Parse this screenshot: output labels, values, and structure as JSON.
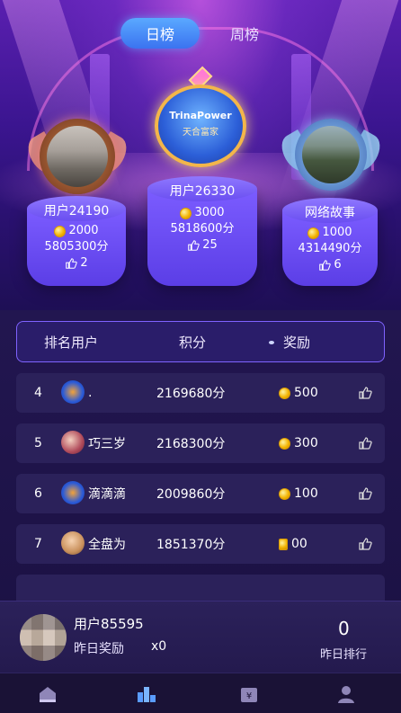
{
  "tabs": [
    {
      "label": "日榜",
      "active": true
    },
    {
      "label": "周榜",
      "active": false
    }
  ],
  "crown": {
    "brand": "TrinaPower",
    "brand_cn": "天合富家"
  },
  "podium": {
    "first": {
      "name": "用户26330",
      "coins": "3000",
      "score": "5818600分",
      "likes": "25"
    },
    "second": {
      "name": "用户24190",
      "coins": "2000",
      "score": "5805300分",
      "likes": "2"
    },
    "third": {
      "name": "网络故事",
      "coins": "1000",
      "score": "4314490分",
      "likes": "6"
    }
  },
  "table": {
    "headers": [
      "排名用户",
      "积分",
      "奖励"
    ],
    "rows": [
      {
        "rank": "4",
        "name": ".",
        "score": "2169680分",
        "reward": "500"
      },
      {
        "rank": "5",
        "name": "巧三岁",
        "score": "2168300分",
        "reward": "300"
      },
      {
        "rank": "6",
        "name": "滴滴滴",
        "score": "2009860分",
        "reward": "100"
      },
      {
        "rank": "7",
        "name": "全盘为",
        "score": "1851370分",
        "reward": "00"
      }
    ]
  },
  "me": {
    "name": "用户85595",
    "yesterday_label": "昨日奖励",
    "yesterday_value": "x0",
    "rank_value": "0",
    "rank_label": "昨日排行"
  },
  "nav": [
    "home-icon",
    "ranking-icon",
    "wallet-icon",
    "profile-icon"
  ],
  "colors": {
    "accent": "#3b73f0",
    "podium": "#6a4ef0",
    "row": "#2b215a",
    "coin": "#f2b200"
  }
}
